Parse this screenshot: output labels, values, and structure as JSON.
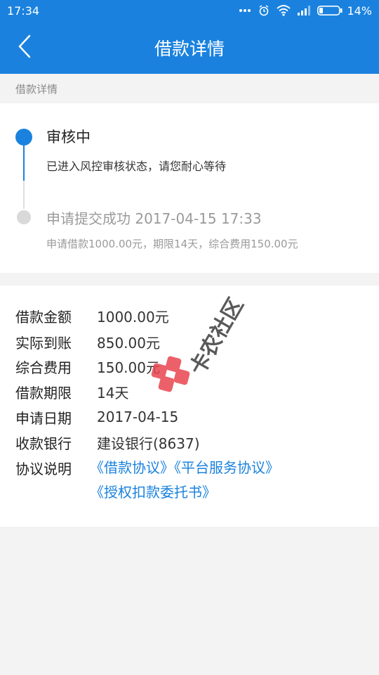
{
  "status_bar": {
    "time": "17:34",
    "battery": "14%"
  },
  "nav": {
    "title": "借款详情"
  },
  "section": {
    "header": "借款详情"
  },
  "timeline": {
    "steps": [
      {
        "title": "审核中",
        "desc": "已进入风控审核状态，请您耐心等待"
      },
      {
        "title": "申请提交成功 2017-04-15 17:33",
        "desc": "申请借款1000.00元，期限14天，综合费用150.00元"
      }
    ]
  },
  "details": {
    "rows": [
      {
        "label": "借款金额",
        "value": "1000.00元"
      },
      {
        "label": "实际到账",
        "value": "850.00元"
      },
      {
        "label": "综合费用",
        "value": "150.00元"
      },
      {
        "label": "借款期限",
        "value": "14天"
      },
      {
        "label": "申请日期",
        "value": "2017-04-15"
      },
      {
        "label": "收款银行",
        "value": "建设银行(8637)"
      }
    ],
    "agreement_label": "协议说明",
    "agreements": [
      "《借款协议》",
      "《平台服务协议》",
      "《授权扣款委托书》"
    ]
  },
  "watermark": {
    "text": "卡农社区"
  },
  "colors": {
    "primary": "#1a82de",
    "background": "#f3f3f3"
  }
}
